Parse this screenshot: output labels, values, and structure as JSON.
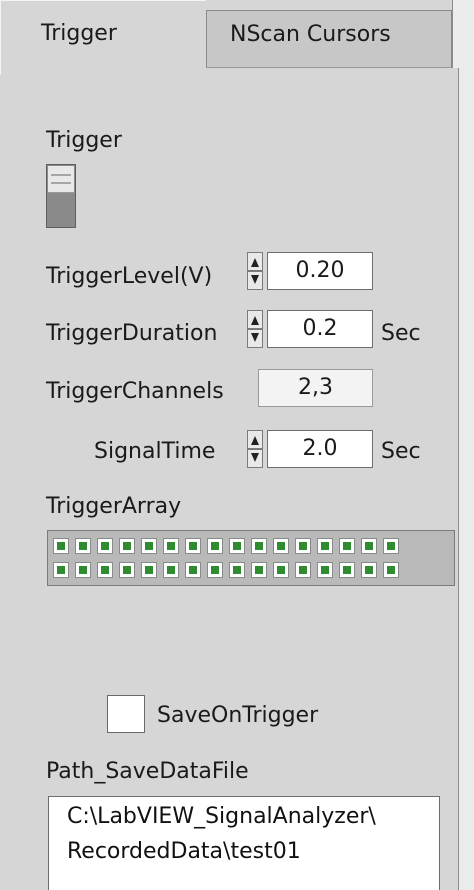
{
  "tabs": [
    {
      "label": "Trigger",
      "active": true
    },
    {
      "label": "NScan Cursors",
      "active": false
    }
  ],
  "trigger_switch": {
    "label": "Trigger",
    "state": "off"
  },
  "trigger_level": {
    "label": "TriggerLevel(V)",
    "value": "0.20"
  },
  "trigger_duration": {
    "label": "TriggerDuration",
    "value": "0.2",
    "unit": "Sec"
  },
  "trigger_channels": {
    "label": "TriggerChannels",
    "value": "2,3"
  },
  "signal_time": {
    "label": "SignalTime",
    "value": "2.0",
    "unit": "Sec"
  },
  "trigger_array": {
    "label": "TriggerArray",
    "rows": 2,
    "columns": 16,
    "led_color": "#2f8d2f"
  },
  "save_on_trigger": {
    "label": "SaveOnTrigger",
    "checked": false
  },
  "path_save_data_file": {
    "label": "Path_SaveDataFile",
    "value": "C:\\LabVIEW_SignalAnalyzer\\\nRecordedData\\test01"
  },
  "colors": {
    "panel_bg": "#d6d6d6",
    "field_bg": "#ffffff",
    "led_on": "#2f8d2f"
  }
}
